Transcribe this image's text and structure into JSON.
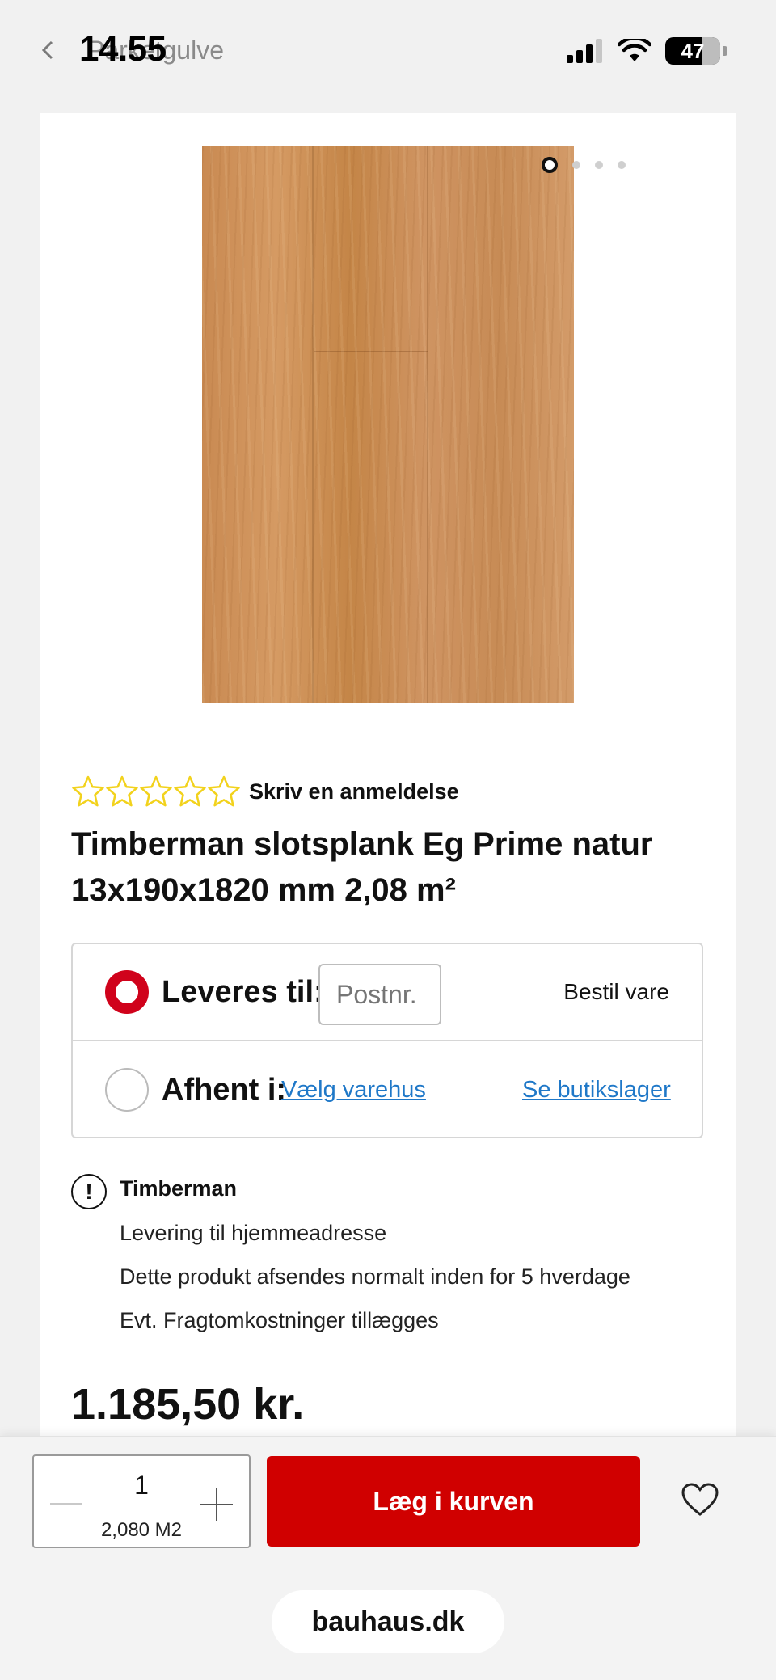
{
  "status_bar": {
    "time": "14.55",
    "battery": "47",
    "back_label": "Parketgulve"
  },
  "gallery": {
    "image_count": 4,
    "active_index": 0
  },
  "product": {
    "rating_stars": 0,
    "rating_max": 5,
    "review_link": "Skriv en anmeldelse",
    "title": "Timberman slotsplank Eg Prime natur 13x190x1820 mm 2,08 m²",
    "price": "1.185,50 kr."
  },
  "delivery": {
    "deliver_label": "Leveres til:",
    "postcode_placeholder": "Postnr.",
    "order_text": "Bestil vare",
    "pickup_label": "Afhent i:",
    "choose_store": "Vælg varehus",
    "store_stock": "Se butikslager"
  },
  "info": {
    "title": "Timberman",
    "lines": [
      "Levering til hjemmeadresse",
      "Dette produkt afsendes normalt inden for 5 hverdage",
      "Evt. Fragtomkostninger tillægges"
    ]
  },
  "cart_bar": {
    "quantity": "1",
    "unit_amount": "2,080 M2",
    "add_to_cart": "Læg i kurven"
  },
  "browser": {
    "url": "bauhaus.dk"
  },
  "colors": {
    "accent_red": "#d00000",
    "link_blue": "#1f78c8",
    "star_yellow": "#f2d21c"
  }
}
